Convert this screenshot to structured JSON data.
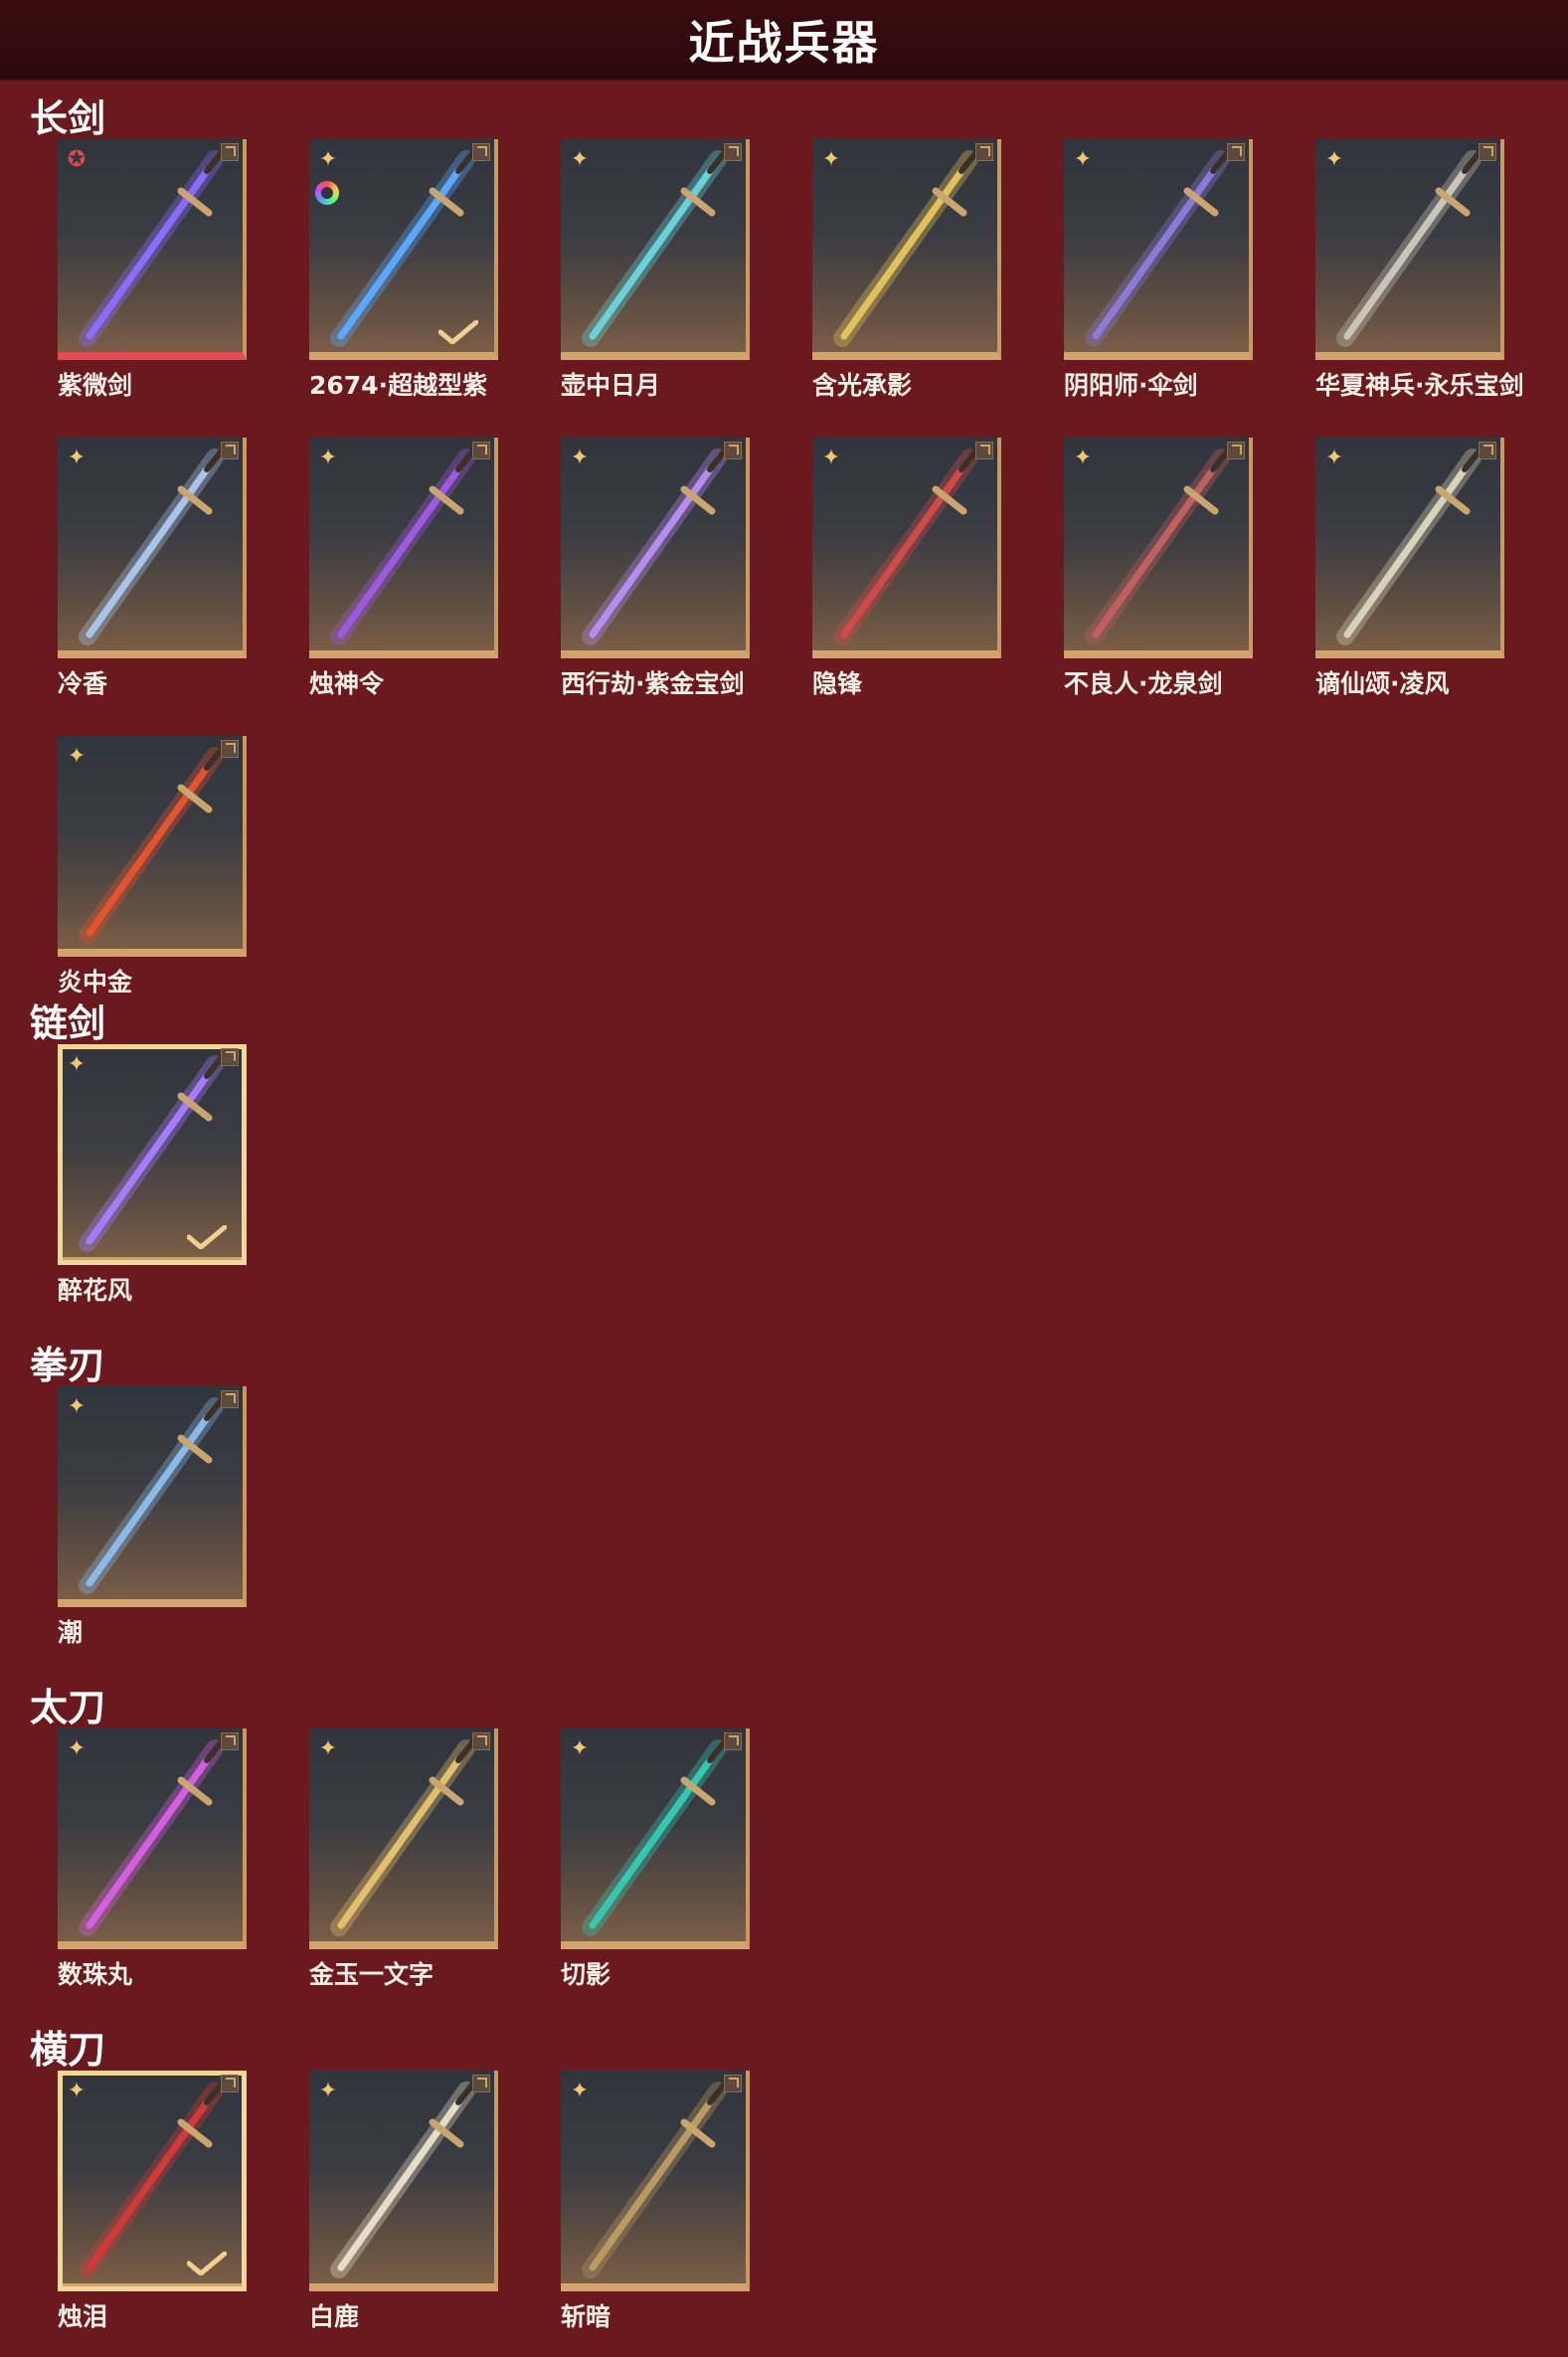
{
  "header": {
    "title": "近战兵器"
  },
  "sections": [
    {
      "title": "长剑",
      "items": [
        {
          "name": "紫微剑",
          "star": "red",
          "color": "#8b6cff"
        },
        {
          "name": "2674·超越型紫",
          "color": "#5aa8ff",
          "ring": true,
          "checked": true
        },
        {
          "name": "壶中日月",
          "color": "#68d2d8"
        },
        {
          "name": "含光承影",
          "color": "#e0c25a"
        },
        {
          "name": "阴阳师·伞剑",
          "color": "#8c79d8"
        },
        {
          "name": "华夏神兵·永乐宝剑",
          "color": "#c9c6b8"
        },
        {
          "name": "冷香",
          "color": "#a9c4e8"
        },
        {
          "name": "烛神令",
          "color": "#9c5ae0"
        },
        {
          "name": "西行劫·紫金宝剑",
          "color": "#b58cf0"
        },
        {
          "name": "隐锋",
          "color": "#d04a4a"
        },
        {
          "name": "不良人·龙泉剑",
          "color": "#c06060"
        },
        {
          "name": "谪仙颂·凌风",
          "color": "#d8d2b8"
        },
        {
          "name": "炎中金",
          "color": "#e2532e"
        }
      ]
    },
    {
      "title": "链剑",
      "items": [
        {
          "name": "醉花风",
          "color": "#a67cff",
          "selected": true,
          "checked": true
        }
      ]
    },
    {
      "title": "拳刃",
      "items": [
        {
          "name": "潮",
          "color": "#8bb9e8"
        }
      ]
    },
    {
      "title": "太刀",
      "items": [
        {
          "name": "数珠丸",
          "color": "#d35ee0"
        },
        {
          "name": "金玉一文字",
          "color": "#e2c06b"
        },
        {
          "name": "切影",
          "color": "#36c7b0"
        }
      ]
    },
    {
      "title": "横刀",
      "items": [
        {
          "name": "烛泪",
          "color": "#d23a3a",
          "selected": true,
          "checked": true
        },
        {
          "name": "白鹿",
          "color": "#e6ddc6"
        },
        {
          "name": "斩暗",
          "color": "#b89a62"
        }
      ]
    }
  ]
}
